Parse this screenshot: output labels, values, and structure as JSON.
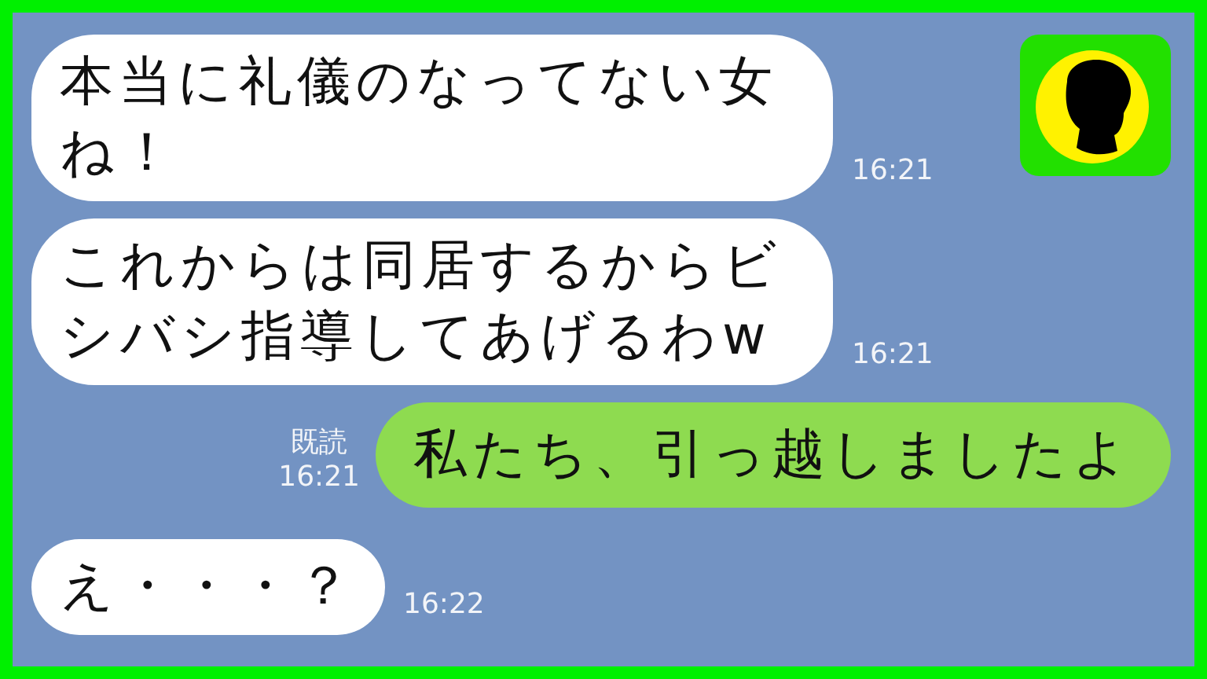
{
  "messages": [
    {
      "kind": "received",
      "text": "本当に礼儀のなってない女ね！",
      "time": "16:21"
    },
    {
      "kind": "received",
      "text": "これからは同居するからビシバシ指導してあげるわw",
      "time": "16:21"
    },
    {
      "kind": "sent",
      "text": "私たち、引っ越しましたよ",
      "read": "既読",
      "time": "16:21"
    },
    {
      "kind": "received",
      "text": "え・・・？",
      "time": "16:22"
    }
  ]
}
